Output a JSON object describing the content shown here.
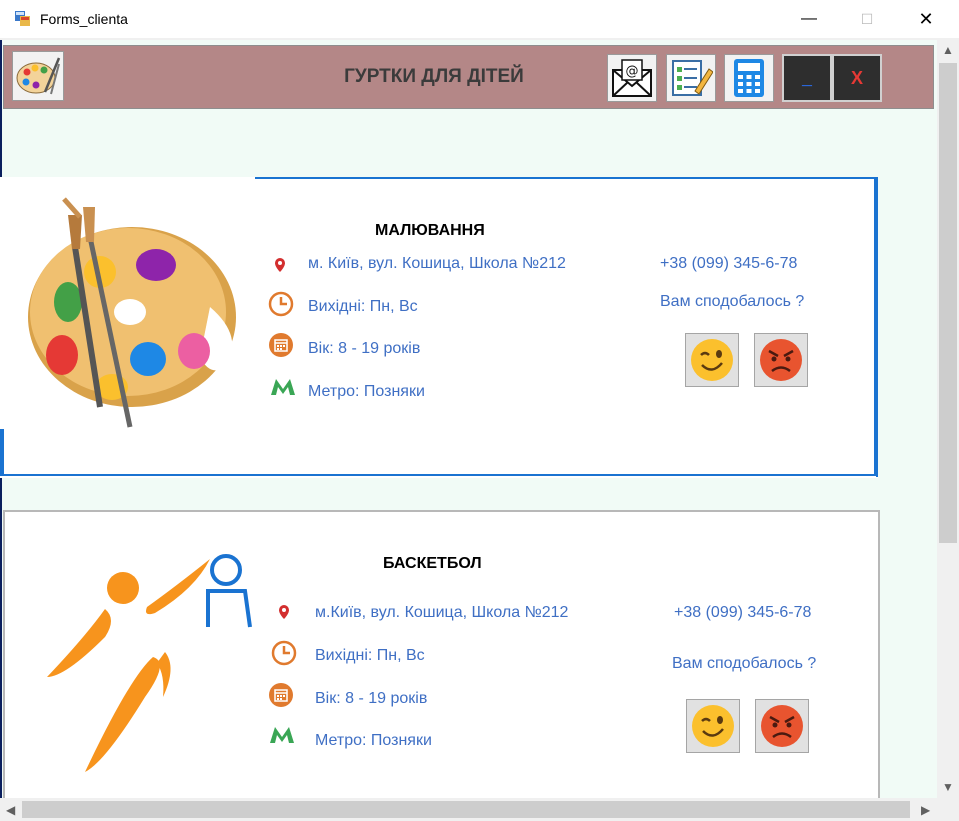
{
  "window": {
    "title": "Forms_clienta",
    "minimize": "—",
    "maximize": "☐",
    "close": "✕"
  },
  "header": {
    "title": "ГУРТКИ ДЛЯ ДІТЕЙ",
    "minimize_label": "_",
    "close_label": "X"
  },
  "cards": [
    {
      "title": "МАЛЮВАННЯ",
      "address": "м. Київ, вул. Кошица, Школа №212",
      "schedule": "Вихідні: Пн, Вс",
      "age": "Вік: 8 - 19 років",
      "metro": "Метро: Позняки",
      "phone": "+38 (099) 345-6-78",
      "question": "Вам сподобалось ?"
    },
    {
      "title": "БАСКЕТБОЛ",
      "address": "м.Київ, вул. Кошица, Школа №212",
      "schedule": "Вихідні: Пн, Вс",
      "age": "Вік: 8 - 19 років",
      "metro": "Метро: Позняки",
      "phone": "+38 (099) 345-6-78",
      "question": "Вам сподобалось ?"
    }
  ],
  "colors": {
    "header_bg": "#b48787",
    "accent": "#1a73d1",
    "info_text": "#3f6fc4",
    "icon_orange": "#e07a2e",
    "metro_green": "#3aa655"
  }
}
